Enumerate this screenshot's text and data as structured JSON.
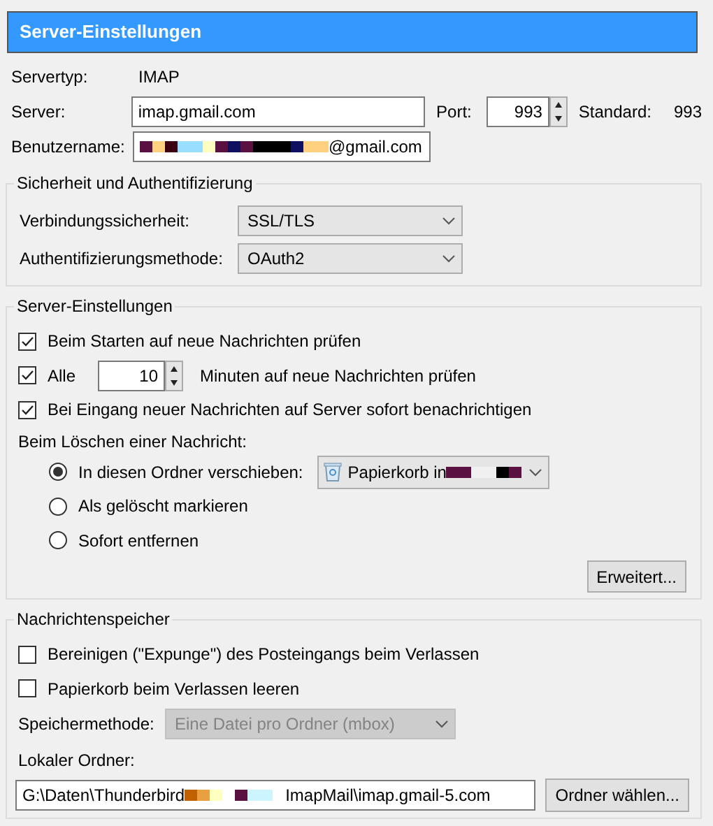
{
  "header": {
    "title": "Server-Einstellungen"
  },
  "server_type": {
    "label": "Servertyp:",
    "value": "IMAP"
  },
  "server": {
    "label": "Server:",
    "value": "imap.gmail.com"
  },
  "port": {
    "label": "Port:",
    "value": "993"
  },
  "default_port": {
    "label": "Standard:",
    "value": "993"
  },
  "username": {
    "label": "Benutzername:",
    "value": "@gmail.com",
    "redacted": true
  },
  "security": {
    "title": "Sicherheit und Authentifizierung",
    "fields": [
      {
        "label": "Verbindungssicherheit:",
        "value": "SSL/TLS"
      },
      {
        "label": "Authentifizierungsmethode:",
        "value": "OAuth2"
      }
    ]
  },
  "server_settings": {
    "title": "Server-Einstellungen",
    "checks": [
      {
        "kind": "check",
        "label": "Beim Starten auf neue Nachrichten prüfen",
        "checked": true
      },
      {
        "kind": "interval",
        "label": "Alle",
        "value": "10",
        "suffix": "Minuten auf neue Nachrichten prüfen",
        "checked": true
      },
      {
        "kind": "check",
        "label": "Bei Eingang neuer Nachrichten auf Server sofort benachrichtigen",
        "checked": true
      }
    ],
    "delete_label": "Beim Löschen einer Nachricht:",
    "delete_options": [
      {
        "label": "In diesen Ordner verschieben:",
        "selected": true,
        "folder": "Papierkorb in",
        "folder_redacted": true
      },
      {
        "label": "Als gelöscht markieren",
        "selected": false
      },
      {
        "label": "Sofort entfernen",
        "selected": false
      }
    ],
    "advanced_button": "Erweitert..."
  },
  "storage": {
    "title": "Nachrichtenspeicher",
    "checks": [
      {
        "kind": "check",
        "label": "Bereinigen (\"Expunge\") des Posteingangs beim Verlassen",
        "checked": false
      },
      {
        "kind": "check",
        "label": "Papierkorb beim Verlassen leeren",
        "checked": false
      }
    ],
    "method": {
      "label": "Speichermethode:",
      "value": "Eine Datei pro Ordner (mbox)",
      "disabled": true
    },
    "local_folder": {
      "label": "Lokaler Ordner:",
      "value_start": "G:\\Daten\\Thunderbird",
      "value_end": "ImapMail\\imap.gmail-5.com",
      "redacted": true
    },
    "choose_button": "Ordner wählen..."
  }
}
